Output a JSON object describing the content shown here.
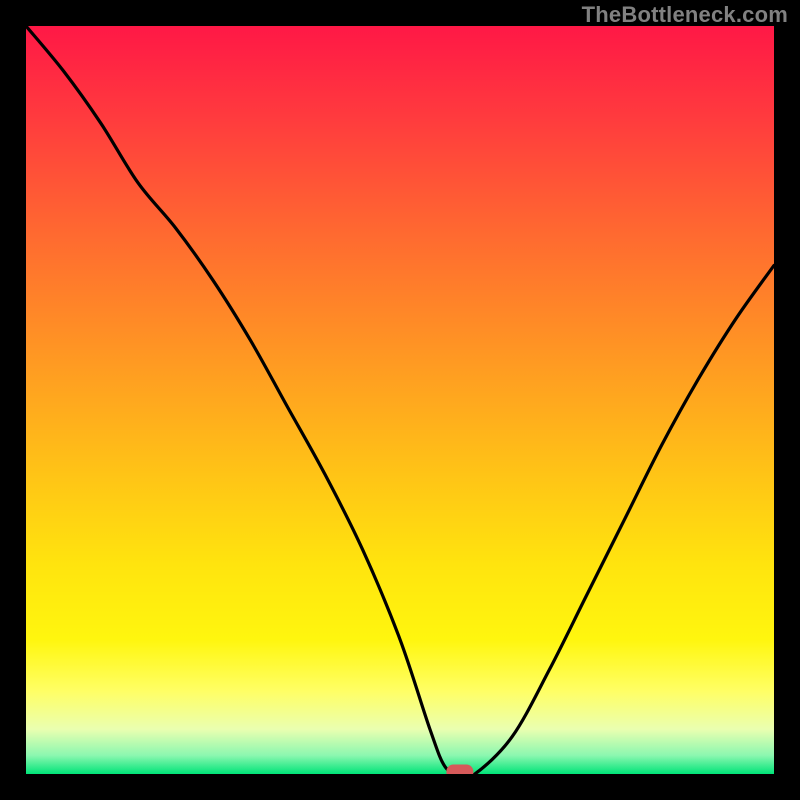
{
  "watermark": "TheBottleneck.com",
  "colors": {
    "page_bg": "#000000",
    "curve": "#000000",
    "marker": "#d65a5a",
    "gradient": [
      {
        "offset": 0.0,
        "hex": "#ff1846"
      },
      {
        "offset": 0.12,
        "hex": "#ff3a3e"
      },
      {
        "offset": 0.28,
        "hex": "#ff6a30"
      },
      {
        "offset": 0.45,
        "hex": "#ff9a22"
      },
      {
        "offset": 0.6,
        "hex": "#ffc416"
      },
      {
        "offset": 0.72,
        "hex": "#ffe40e"
      },
      {
        "offset": 0.82,
        "hex": "#fff60e"
      },
      {
        "offset": 0.89,
        "hex": "#ffff66"
      },
      {
        "offset": 0.94,
        "hex": "#eaffb0"
      },
      {
        "offset": 0.975,
        "hex": "#8cf7b0"
      },
      {
        "offset": 1.0,
        "hex": "#00e478"
      }
    ]
  },
  "chart_data": {
    "type": "line",
    "title": "",
    "xlabel": "",
    "ylabel": "",
    "xlim": [
      0,
      100
    ],
    "ylim": [
      0,
      100
    ],
    "x": [
      0,
      5,
      10,
      15,
      20,
      25,
      30,
      35,
      40,
      45,
      50,
      54,
      56,
      58,
      60,
      65,
      70,
      75,
      80,
      85,
      90,
      95,
      100
    ],
    "values": [
      100,
      94,
      87,
      79,
      73,
      66,
      58,
      49,
      40,
      30,
      18,
      6,
      1,
      0,
      0,
      5,
      14,
      24,
      34,
      44,
      53,
      61,
      68
    ],
    "floor_segment": {
      "x_start": 56,
      "x_end": 60,
      "y": 0
    },
    "marker": {
      "x": 58,
      "y": 0,
      "w": 3.6,
      "h": 2.0
    }
  }
}
